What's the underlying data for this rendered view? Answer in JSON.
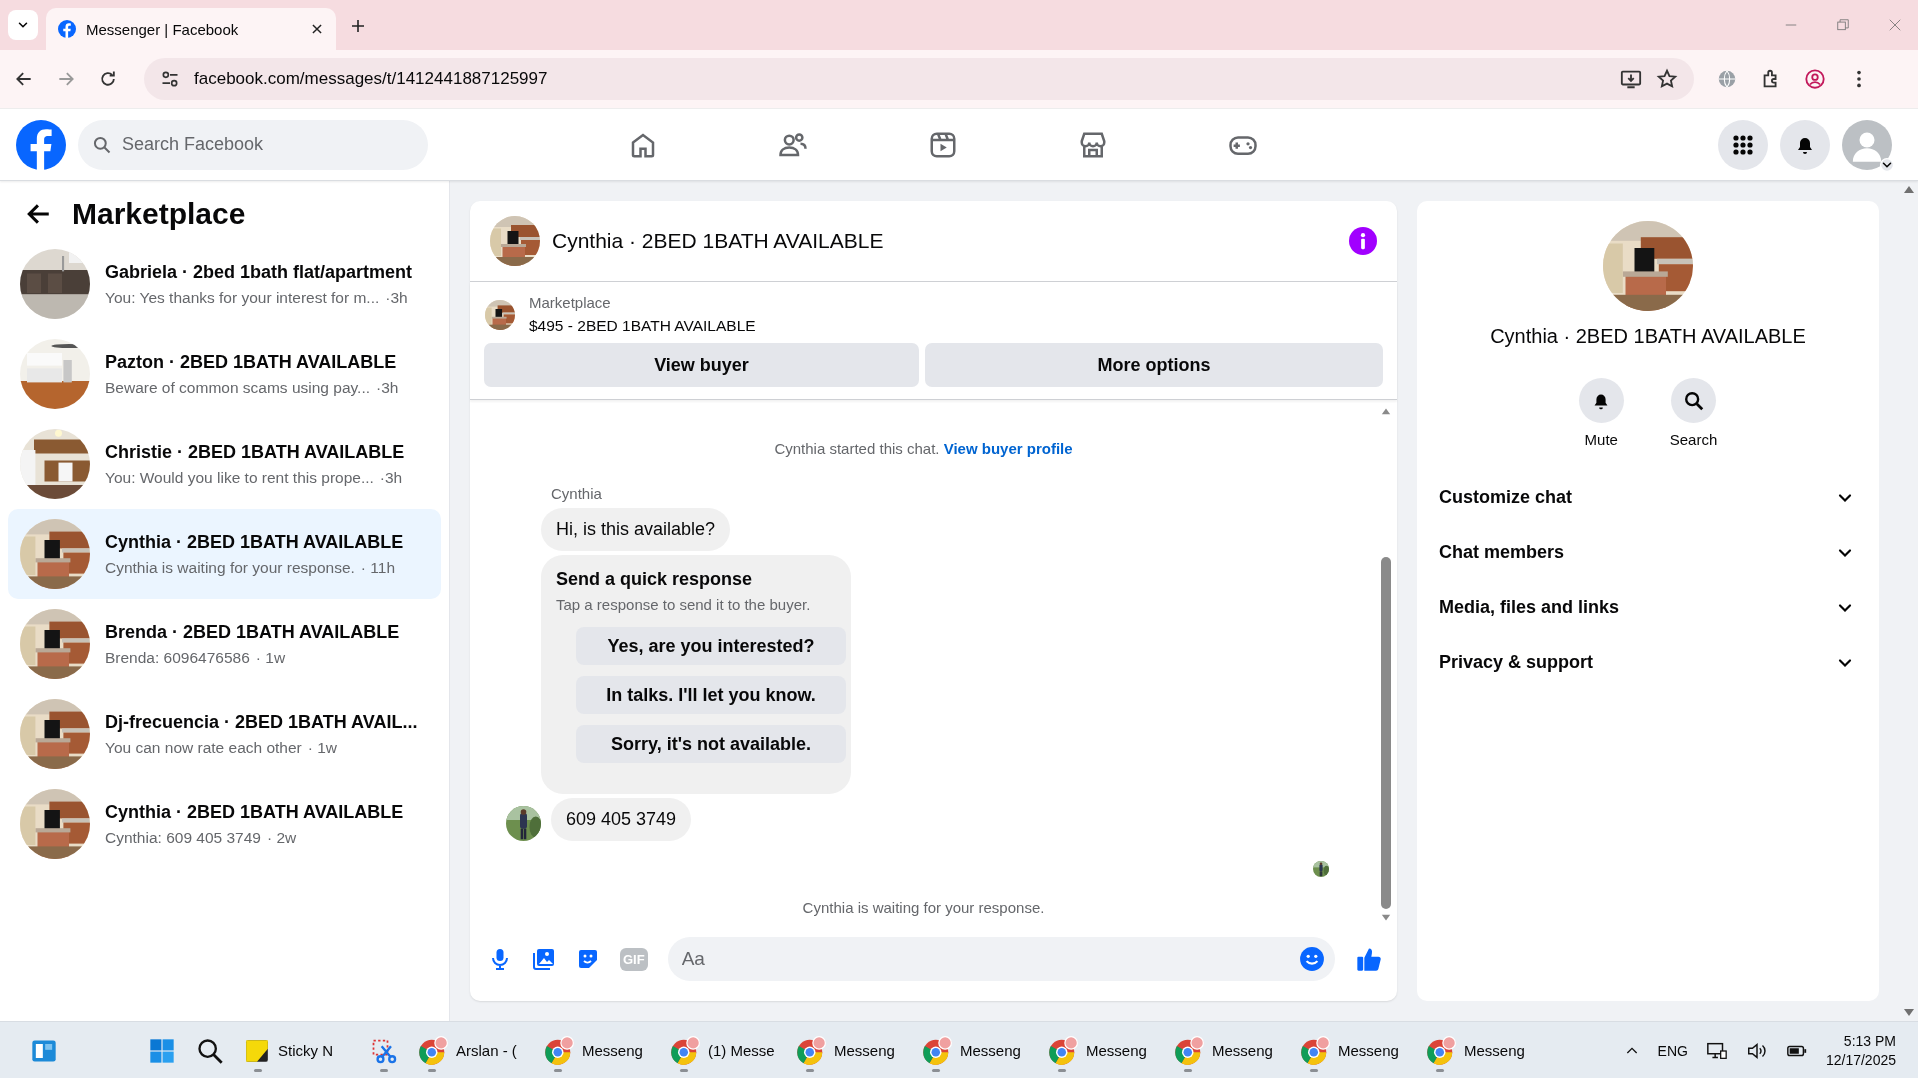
{
  "browser": {
    "tab_title": "Messenger | Facebook",
    "url": "facebook.com/messages/t/1412441887125997"
  },
  "fb_header": {
    "search_placeholder": "Search Facebook",
    "nav": [
      {
        "kind": "home"
      },
      {
        "kind": "friends"
      },
      {
        "kind": "video"
      },
      {
        "kind": "marketplace"
      },
      {
        "kind": "gaming"
      }
    ]
  },
  "sidebar": {
    "title": "Marketplace",
    "conversations": [
      {
        "title": "Gabriela · 2bed 1bath flat/apartment",
        "preview": "You: Yes thanks for your interest for m...",
        "time": "·3h",
        "selected": false
      },
      {
        "title": "Pazton · 2BED 1BATH AVAILABLE",
        "preview": "Beware of common scams using pay...",
        "time": "·3h",
        "selected": false
      },
      {
        "title": "Christie · 2BED 1BATH AVAILABLE",
        "preview": "You: Would you like to rent this prope...",
        "time": "·3h",
        "selected": false
      },
      {
        "title": "Cynthia · 2BED 1BATH AVAILABLE",
        "preview": "Cynthia is waiting for your response.",
        "time": "· 11h",
        "selected": true
      },
      {
        "title": "Brenda · 2BED 1BATH AVAILABLE",
        "preview": "Brenda: 6096476586",
        "time": "· 1w",
        "selected": false
      },
      {
        "title": "Dj-frecuencia · 2BED 1BATH AVAIL...",
        "preview": "You can now rate each other",
        "time": "· 1w",
        "selected": false
      },
      {
        "title": "Cynthia · 2BED 1BATH AVAILABLE",
        "preview": "Cynthia: 609 405 3749",
        "time": "· 2w",
        "selected": false
      }
    ]
  },
  "chat": {
    "title": "Cynthia · 2BED 1BATH AVAILABLE",
    "listing": {
      "label": "Marketplace",
      "detail": "$495 - 2BED 1BATH AVAILABLE",
      "buttons": [
        "View buyer",
        "More options"
      ]
    },
    "notice": {
      "text": "Cynthia started this chat.",
      "link": "View buyer profile"
    },
    "sender": "Cynthia",
    "messages": [
      {
        "kind": "bubble",
        "text": "Hi, is this available?"
      },
      {
        "kind": "quick_response",
        "title": "Send a quick response",
        "hint": "Tap a response to send it to the buyer.",
        "options": [
          "Yes, are you interested?",
          "In talks. I'll let you know.",
          "Sorry, it's not available."
        ]
      },
      {
        "kind": "bubble_avatar",
        "text": "609 405 3749"
      }
    ],
    "status": "Cynthia is waiting for your response.",
    "composer": {
      "placeholder": "Aa",
      "gif": "GIF"
    }
  },
  "details": {
    "title": "Cynthia · 2BED 1BATH AVAILABLE",
    "actions": [
      {
        "kind": "bell",
        "label": "Mute"
      },
      {
        "kind": "search",
        "label": "Search"
      }
    ],
    "sections": [
      {
        "label": "Customize chat",
        "expanded": false
      },
      {
        "label": "Chat members",
        "expanded": false
      },
      {
        "label": "Media, files and links",
        "expanded": false
      },
      {
        "label": "Privacy & support",
        "expanded": false
      }
    ]
  },
  "taskbar": {
    "items": [
      {
        "kind": "widgets"
      },
      {
        "kind": "start"
      },
      {
        "kind": "search"
      },
      {
        "kind": "sticky",
        "label": "Sticky N"
      },
      {
        "kind": "snip"
      },
      {
        "kind": "chrome",
        "label": "Arslan - ("
      },
      {
        "kind": "chrome",
        "label": "Messeng"
      },
      {
        "kind": "chrome",
        "label": "(1) Messe"
      },
      {
        "kind": "chrome",
        "label": "Messeng"
      },
      {
        "kind": "chrome",
        "label": "Messeng"
      },
      {
        "kind": "chrome",
        "label": "Messeng"
      },
      {
        "kind": "chrome",
        "label": "Messeng"
      },
      {
        "kind": "chrome",
        "label": "Messeng"
      },
      {
        "kind": "chrome",
        "label": "Messeng"
      }
    ],
    "language": "ENG",
    "time": "5:13 PM",
    "date": "12/17/2025"
  }
}
